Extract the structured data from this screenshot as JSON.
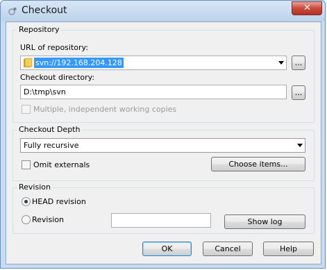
{
  "window": {
    "title": "Checkout",
    "close_label": "✕"
  },
  "repository": {
    "group_label": "Repository",
    "url_label": "URL of repository:",
    "url_value": "svn://192.168.204.128",
    "browse_label": "...",
    "dir_label": "Checkout directory:",
    "dir_value": "D:\\tmp\\svn",
    "dir_browse_label": "...",
    "multi_label": "Multiple, independent working copies"
  },
  "depth": {
    "group_label": "Checkout Depth",
    "selected": "Fully recursive",
    "omit_label": "Omit externals",
    "choose_label": "Choose items..."
  },
  "revision": {
    "group_label": "Revision",
    "head_label": "HEAD revision",
    "rev_label": "Revision",
    "rev_value": "",
    "showlog_label": "Show log"
  },
  "footer": {
    "ok_label": "OK",
    "cancel_label": "Cancel",
    "help_label": "Help"
  }
}
